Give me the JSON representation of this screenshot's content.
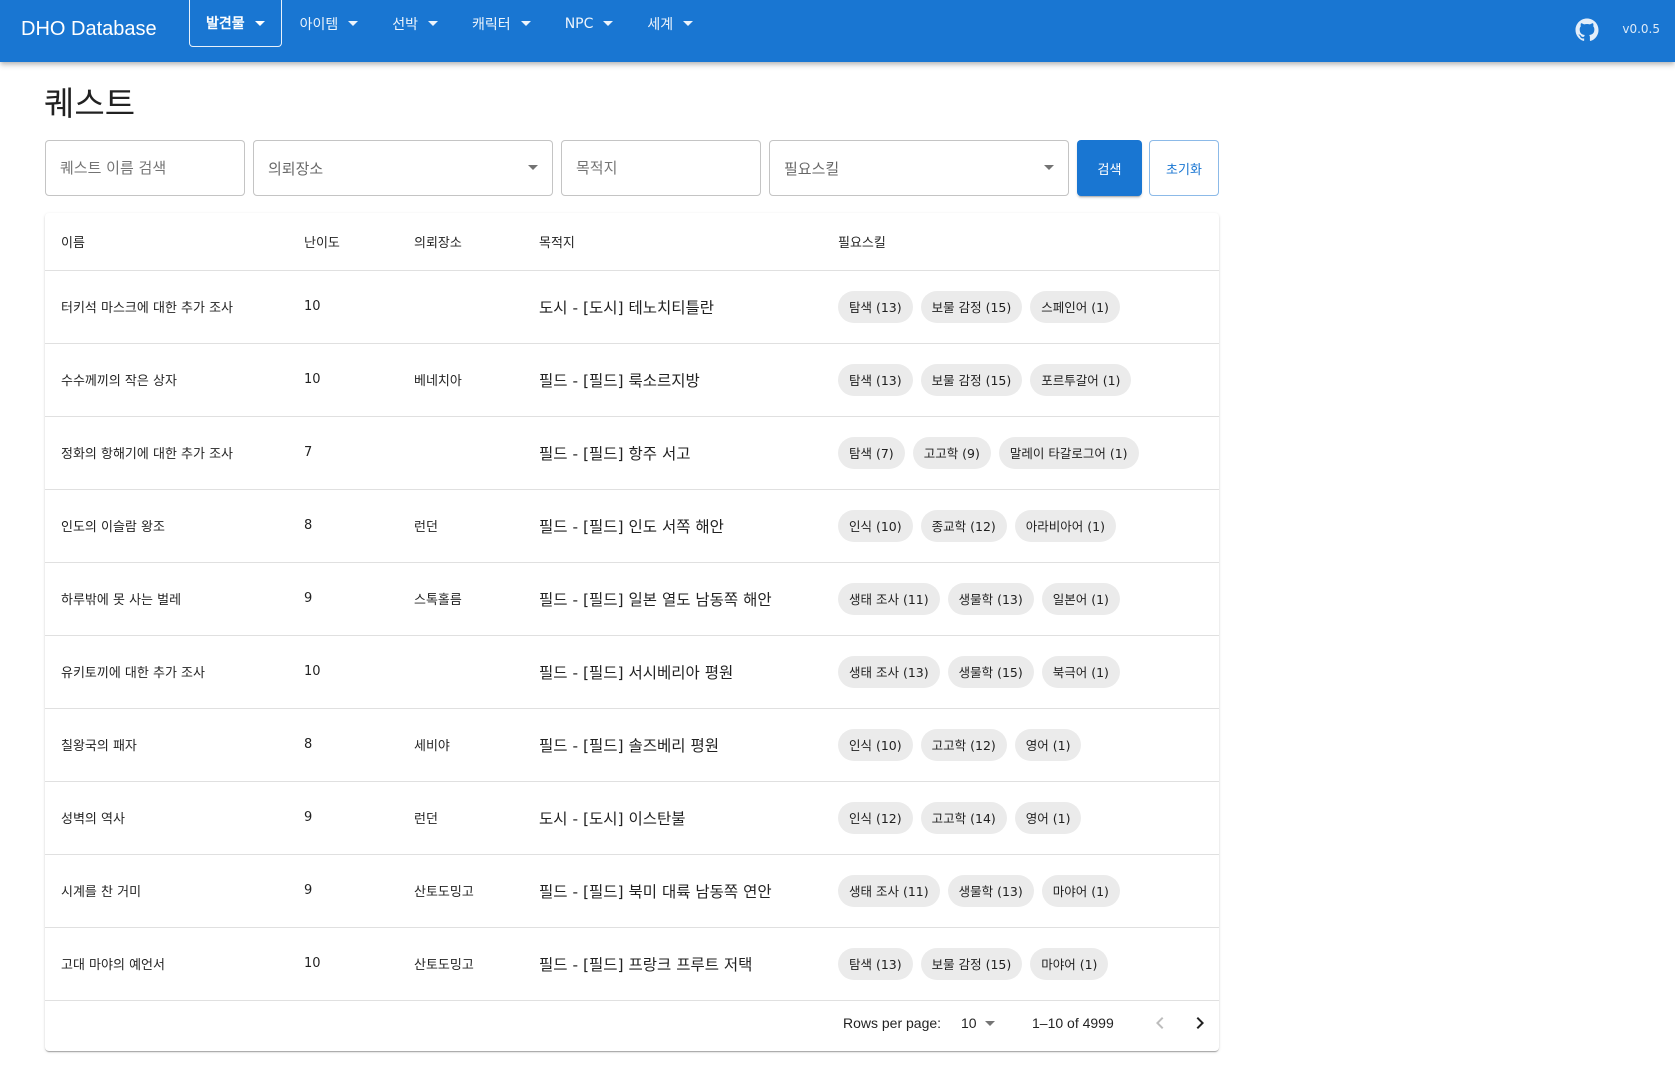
{
  "header": {
    "brand": "DHO Database",
    "nav": [
      {
        "label": "발견물",
        "active": true
      },
      {
        "label": "아이템",
        "active": false
      },
      {
        "label": "선박",
        "active": false
      },
      {
        "label": "캐릭터",
        "active": false
      },
      {
        "label": "NPC",
        "active": false
      },
      {
        "label": "세계",
        "active": false
      }
    ],
    "github_icon": "github-icon",
    "version": "v0.0.5"
  },
  "page": {
    "title": "퀘스트"
  },
  "filters": {
    "name_placeholder": "퀘스트 이름 검색",
    "client_label": "의뢰장소",
    "destination_placeholder": "목적지",
    "skill_label": "필요스킬",
    "search_button": "검색",
    "reset_button": "초기화"
  },
  "table": {
    "columns": [
      "이름",
      "난이도",
      "의뢰장소",
      "목적지",
      "필요스킬"
    ],
    "rows": [
      {
        "name": "터키석 마스크에 대한 추가 조사",
        "difficulty": "10",
        "client": "",
        "destination": "도시 - [도시] 테노치티틀란",
        "skills": [
          "탐색 (13)",
          "보물 감정 (15)",
          "스페인어 (1)"
        ]
      },
      {
        "name": "수수께끼의 작은 상자",
        "difficulty": "10",
        "client": "베네치아",
        "destination": "필드 - [필드] 룩소르지방",
        "skills": [
          "탐색 (13)",
          "보물 감정 (15)",
          "포르투갈어 (1)"
        ]
      },
      {
        "name": "정화의 항해기에 대한 추가 조사",
        "difficulty": "7",
        "client": "",
        "destination": "필드 - [필드] 항주 서고",
        "skills": [
          "탐색 (7)",
          "고고학 (9)",
          "말레이 타갈로그어 (1)"
        ]
      },
      {
        "name": "인도의 이슬람 왕조",
        "difficulty": "8",
        "client": "런던",
        "destination": "필드 - [필드] 인도 서쪽 해안",
        "skills": [
          "인식 (10)",
          "종교학 (12)",
          "아라비아어 (1)"
        ]
      },
      {
        "name": "하루밖에 못 사는 벌레",
        "difficulty": "9",
        "client": "스톡홀름",
        "destination": "필드 - [필드] 일본 열도 남동쪽 해안",
        "skills": [
          "생태 조사 (11)",
          "생물학 (13)",
          "일본어 (1)"
        ]
      },
      {
        "name": "유키토끼에 대한 추가 조사",
        "difficulty": "10",
        "client": "",
        "destination": "필드 - [필드] 서시베리아 평원",
        "skills": [
          "생태 조사 (13)",
          "생물학 (15)",
          "북극어 (1)"
        ]
      },
      {
        "name": "칠왕국의 패자",
        "difficulty": "8",
        "client": "세비야",
        "destination": "필드 - [필드] 솔즈베리 평원",
        "skills": [
          "인식 (10)",
          "고고학 (12)",
          "영어 (1)"
        ]
      },
      {
        "name": "성벽의 역사",
        "difficulty": "9",
        "client": "런던",
        "destination": "도시 - [도시] 이스탄불",
        "skills": [
          "인식 (12)",
          "고고학 (14)",
          "영어 (1)"
        ]
      },
      {
        "name": "시계를 찬 거미",
        "difficulty": "9",
        "client": "산토도밍고",
        "destination": "필드 - [필드] 북미 대륙 남동쪽 연안",
        "skills": [
          "생태 조사 (11)",
          "생물학 (13)",
          "마야어 (1)"
        ]
      },
      {
        "name": "고대 마야의 예언서",
        "difficulty": "10",
        "client": "산토도밍고",
        "destination": "필드 - [필드] 프랑크 프루트 저택",
        "skills": [
          "탐색 (13)",
          "보물 감정 (15)",
          "마야어 (1)"
        ]
      }
    ]
  },
  "pagination": {
    "rows_per_page_label": "Rows per page:",
    "rows_per_page_value": "10",
    "range": "1–10 of 4999",
    "prev_icon": "chevron-left-icon",
    "next_icon": "chevron-right-icon"
  },
  "colors": {
    "primary": "#1976d2",
    "chip": "#ebebeb"
  }
}
